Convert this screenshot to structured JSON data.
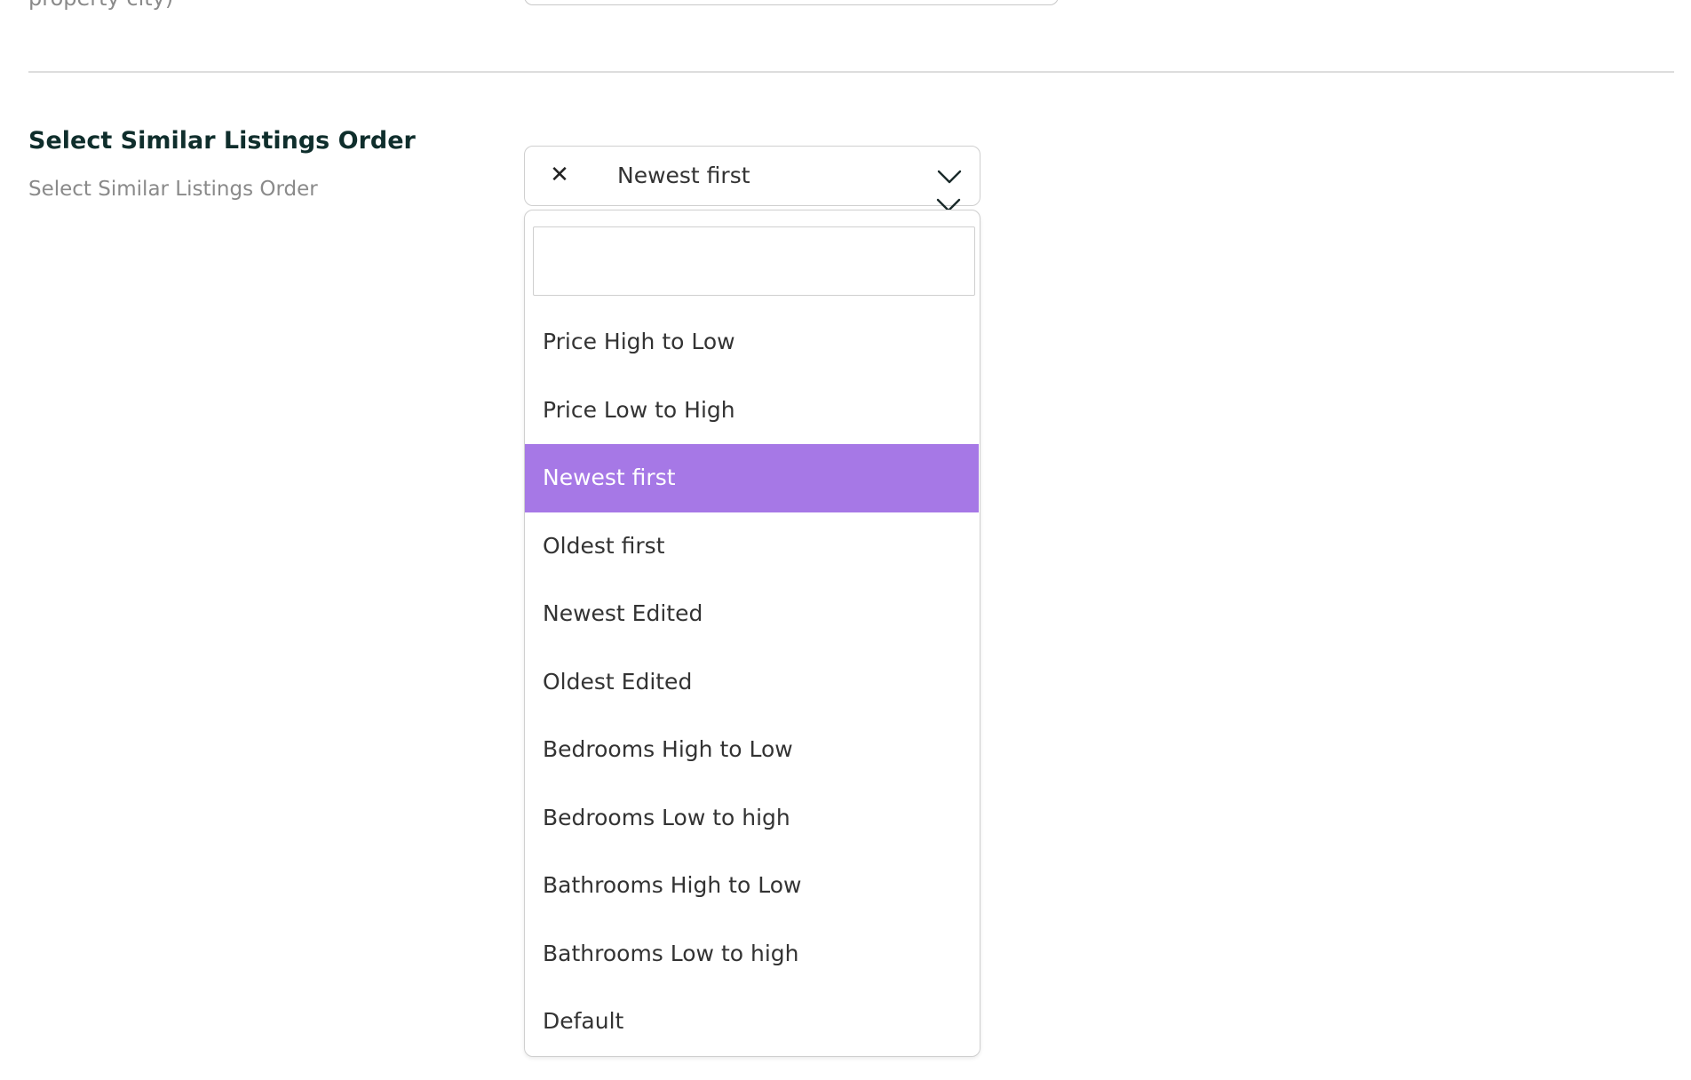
{
  "previous_setting": {
    "hint_fragment": "property city)"
  },
  "setting": {
    "title": "Select Similar Listings Order",
    "description": "Select Similar Listings Order",
    "selected_value": "Newest first",
    "search_value": "",
    "options": [
      "Price High to Low",
      "Price Low to High",
      "Newest first",
      "Oldest first",
      "Newest Edited",
      "Oldest Edited",
      "Bedrooms High to Low",
      "Bedrooms Low to high",
      "Bathrooms High to Low",
      "Bathrooms Low to high",
      "Default"
    ],
    "highlighted_index": 2
  },
  "icons": {
    "clear": "close-icon",
    "toggle": "chevron-down-icon"
  },
  "colors": {
    "highlight": "#a678e6",
    "title": "#0f2e2c",
    "muted_text": "#8a8a8a"
  }
}
